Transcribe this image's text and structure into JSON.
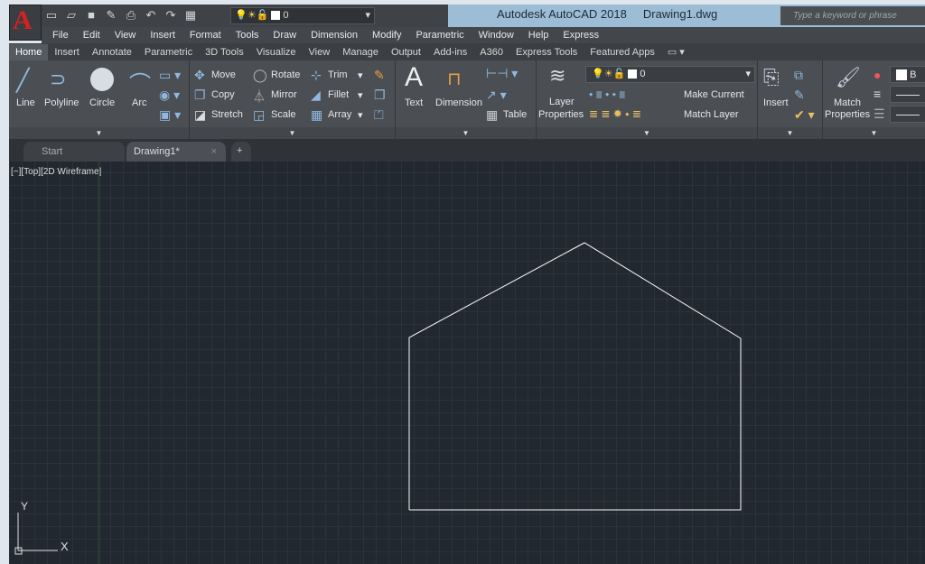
{
  "app": {
    "logo": "A",
    "title": "Autodesk AutoCAD 2018",
    "document": "Drawing1.dwg",
    "search_placeholder": "Type a keyword or phrase",
    "layer_value": "0"
  },
  "qat": [
    "new-icon",
    "open-icon",
    "save-icon",
    "save-as-icon",
    "plot-icon",
    "undo-icon",
    "redo-icon",
    "workspace-icon"
  ],
  "menu": [
    "File",
    "Edit",
    "View",
    "Insert",
    "Format",
    "Tools",
    "Draw",
    "Dimension",
    "Modify",
    "Parametric",
    "Window",
    "Help",
    "Express"
  ],
  "ribbon_tabs": [
    "Home",
    "Insert",
    "Annotate",
    "Parametric",
    "3D Tools",
    "Visualize",
    "View",
    "Manage",
    "Output",
    "Add-ins",
    "A360",
    "Express Tools",
    "Featured Apps"
  ],
  "draw": {
    "line": "Line",
    "polyline": "Polyline",
    "circle": "Circle",
    "arc": "Arc"
  },
  "modify": {
    "move": "Move",
    "rotate": "Rotate",
    "trim": "Trim",
    "copy": "Copy",
    "mirror": "Mirror",
    "fillet": "Fillet",
    "stretch": "Stretch",
    "scale": "Scale",
    "array": "Array"
  },
  "annotation": {
    "text": "Text",
    "dimension": "Dimension",
    "table": "Table"
  },
  "layers": {
    "properties1": "Layer",
    "properties2": "Properties",
    "layer_value": "0",
    "make_current": "Make Current",
    "match_layer": "Match Layer"
  },
  "block": {
    "insert": "Insert"
  },
  "properties": {
    "match1": "Match",
    "match2": "Properties",
    "color": "B"
  },
  "file_tabs": {
    "start": "Start",
    "drawing": "Drawing1*",
    "close": "×",
    "new": "+"
  },
  "viewport": {
    "label": "[−][Top][2D Wireframe]",
    "ucs_x": "X",
    "ucs_y": "Y"
  },
  "colors": {
    "canvas": "#212830",
    "ribbon": "#4b4f54",
    "title": "#9dbdd6",
    "geometry": "#ffffff"
  }
}
